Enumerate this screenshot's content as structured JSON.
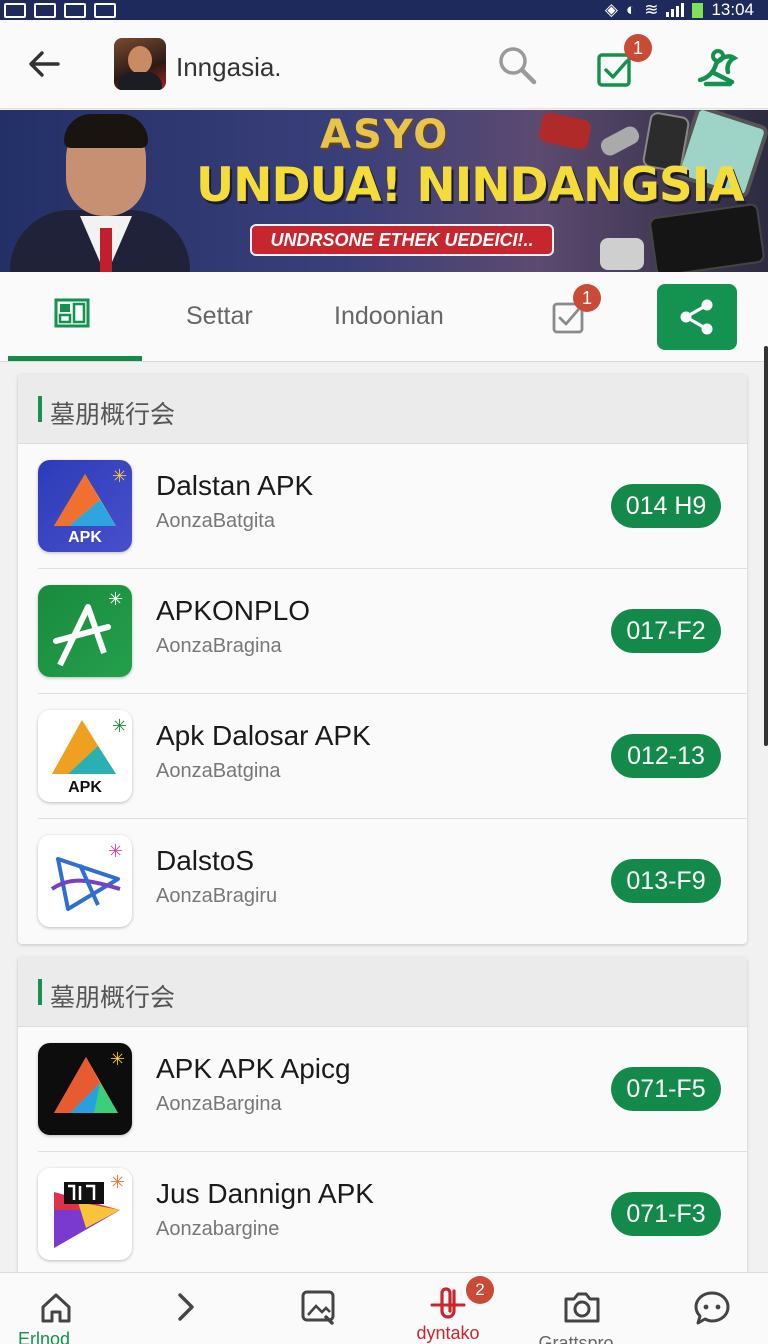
{
  "status_bar": {
    "time": "13:04"
  },
  "header": {
    "title": "Inngasia.",
    "notification_count": "1"
  },
  "banner": {
    "logo_text": "ASYO",
    "headline": "UNDUA! NINDANGSIA",
    "subline": "UNDRSONE ETHEK UEDEICI!.."
  },
  "tabs": {
    "items": [
      {
        "label": "",
        "icon": "grid-icon",
        "active": true
      },
      {
        "label": "Settar"
      },
      {
        "label": "Indoonian"
      }
    ],
    "notification_count": "1",
    "share_icon": "share-icon"
  },
  "sections": [
    {
      "title": "墓朋概行会",
      "apps": [
        {
          "name": "Dalstan APK",
          "publisher": "AonzaBatgita",
          "value": "014 H9",
          "icon": "apk-triangle-icon",
          "icon_text": "APK"
        },
        {
          "name": "APKONPLO",
          "publisher": "AonzaBragina",
          "value": "017-F2",
          "icon": "apk-arrow-icon"
        },
        {
          "name": "Apk Dalosar APK",
          "publisher": "AonzaBatgina",
          "value": "012-13",
          "icon": "apk-yellow-triangle-icon",
          "icon_text": "APK"
        },
        {
          "name": "DalstoS",
          "publisher": "AonzaBragiru",
          "value": "013-F9",
          "icon": "apk-blue-triangle-icon"
        }
      ]
    },
    {
      "title": "墓朋概行会",
      "apps": [
        {
          "name": "APK APK Apicg",
          "publisher": "AonzaBargina",
          "value": "071-F5",
          "icon": "apk-dark-triangle-icon"
        },
        {
          "name": "Jus Dannign APK",
          "publisher": "Aonzabargine",
          "value": "071-F3",
          "icon": "apk-colorful-icon"
        }
      ]
    }
  ],
  "bottom_nav": {
    "items": [
      {
        "label": "Erlnod",
        "icon": "home-icon"
      },
      {
        "label": "",
        "icon": "chevron-right-icon"
      },
      {
        "label": "",
        "icon": "image-edit-icon"
      },
      {
        "label": "dyntako",
        "icon": "paperclip-icon",
        "badge": "2"
      },
      {
        "label": "Grattspro",
        "icon": "camera-icon"
      },
      {
        "label": "",
        "icon": "chat-icon"
      }
    ]
  },
  "colors": {
    "accent": "#138a4a",
    "badge": "#c94a35",
    "status_bar": "#1f2a5c",
    "active_nav": "#c8262e"
  }
}
